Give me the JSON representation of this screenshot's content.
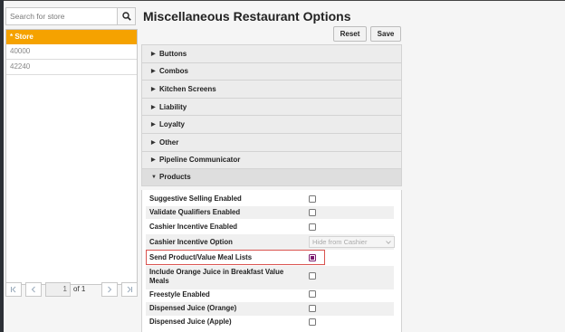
{
  "search": {
    "placeholder": "Search for store"
  },
  "store_list": {
    "header": "* Store",
    "rows": [
      "40000",
      "42240"
    ]
  },
  "pager": {
    "page": "1",
    "of_label": "of 1"
  },
  "page_title": "Miscellaneous Restaurant Options",
  "toolbar": {
    "reset_label": "Reset",
    "save_label": "Save"
  },
  "sections": [
    "Buttons",
    "Combos",
    "Kitchen Screens",
    "Liability",
    "Loyalty",
    "Other",
    "Pipeline Communicator",
    "Products"
  ],
  "products": {
    "rows": [
      {
        "label": "Suggestive Selling Enabled",
        "checked": false
      },
      {
        "label": "Validate Qualifiers Enabled",
        "checked": false
      },
      {
        "label": "Cashier Incentive Enabled",
        "checked": false
      },
      {
        "label": "Cashier Incentive Option",
        "select_value": "Hide from Cashier"
      },
      {
        "label": "Send Product/Value Meal Lists",
        "checked": true
      },
      {
        "label_line1": "Include Orange Juice in Breakfast Value",
        "label_line2": "Meals",
        "checked": false
      },
      {
        "label": "Freestyle Enabled",
        "checked": false
      },
      {
        "label": "Dispensed Juice (Orange)",
        "checked": false
      },
      {
        "label": "Dispensed Juice (Apple)",
        "checked": false
      }
    ]
  },
  "icons": {
    "search": "search-icon",
    "first": "first-page-icon",
    "prev": "prev-page-icon",
    "next": "next-page-icon",
    "last": "last-page-icon",
    "collapsed": "caret-right-icon",
    "expanded": "caret-down-icon",
    "select": "chevron-down-icon"
  },
  "colors": {
    "store_header": "#f5a200",
    "highlight": "#d9534f",
    "checkbox_checked": "#7a1a6e"
  }
}
